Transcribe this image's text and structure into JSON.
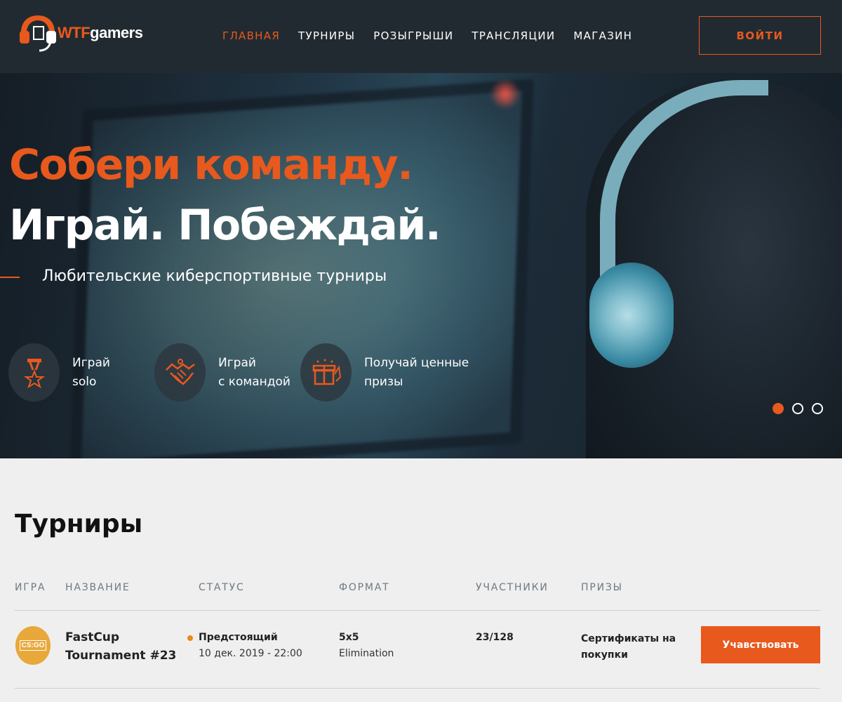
{
  "brand": {
    "logo_wtf": "WTF",
    "logo_gamers": "gamers",
    "accent": "#e8591d",
    "header_bg": "#222a31"
  },
  "nav": {
    "items": [
      {
        "label": "ГЛАВНАЯ",
        "active": true
      },
      {
        "label": "ТУРНИРЫ",
        "active": false
      },
      {
        "label": "РОЗЫГРЫШИ",
        "active": false
      },
      {
        "label": "ТРАНСЛЯЦИИ",
        "active": false
      },
      {
        "label": "МАГАЗИН",
        "active": false
      }
    ],
    "login_label": "ВОЙТИ"
  },
  "hero": {
    "line1": "Собери команду.",
    "line2": "Играй. Побеждай.",
    "subtitle": "Любительские киберспортивные турниры",
    "features": [
      {
        "icon": "medal-icon",
        "line1": "Играй",
        "line2": "solo"
      },
      {
        "icon": "handshake-icon",
        "line1": "Играй",
        "line2": "с командой"
      },
      {
        "icon": "gift-icon",
        "line1": "Получай ценные",
        "line2": "призы"
      }
    ],
    "slider": {
      "total": 3,
      "active_index": 0
    }
  },
  "tournaments": {
    "title": "Турниры",
    "columns": [
      "ИГРА",
      "НАЗВАНИЕ",
      "СТАТУС",
      "ФОРМАТ",
      "УЧАСТНИКИ",
      "ПРИЗЫ"
    ],
    "rows": [
      {
        "game_logo_text": "CS:GO",
        "name": "FastCup Tournament #23",
        "status": "Предстоящий",
        "status_color": "#e8891d",
        "date": "10 дек. 2019 - 22:00",
        "format": "5x5",
        "format_type": "Elimination",
        "participants": "23/128",
        "prizes": "Сертификаты на покупки",
        "action_label": "Учавствовать"
      }
    ]
  }
}
